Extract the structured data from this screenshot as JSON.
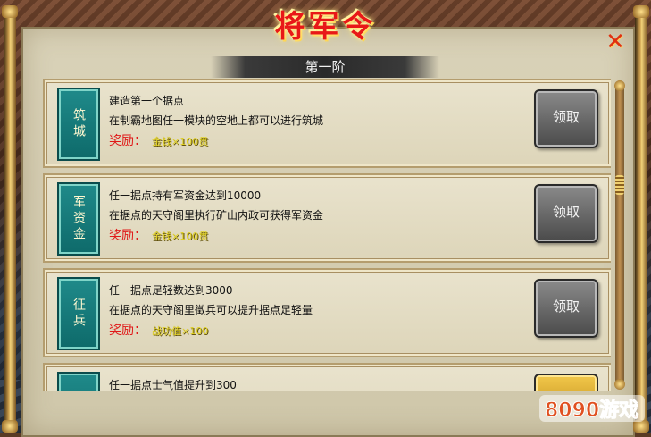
{
  "window": {
    "title": "将军令",
    "close_label": "✕"
  },
  "tier": {
    "label": "第一阶"
  },
  "cards": [
    {
      "emblem": "筑城",
      "line1": "建造第一个据点",
      "line2": "在制霸地图任一模块的空地上都可以进行筑城",
      "reward_label": "奖励：",
      "reward_value": "金钱×100贯",
      "button": "领取"
    },
    {
      "emblem": "军资金",
      "line1": "任一据点持有军资金达到10000",
      "line2": "在据点的天守阁里执行矿山内政可获得军资金",
      "reward_label": "奖励：",
      "reward_value": "金钱×100贯",
      "button": "领取"
    },
    {
      "emblem": "征兵",
      "line1": "任一据点足轻数达到3000",
      "line2": "在据点的天守阁里徵兵可以提升据点足轻量",
      "reward_label": "奖励：",
      "reward_value": "战功值×100",
      "button": "领取"
    },
    {
      "emblem": "",
      "line1": "任一据点士气值提升到300",
      "line2": "",
      "reward_label": "",
      "reward_value": "",
      "button": ""
    }
  ],
  "watermark": {
    "text": "8090游戏"
  },
  "colors": {
    "title": "#e81818",
    "reward_label": "#e01818",
    "emblem": "#1f8a8a"
  }
}
